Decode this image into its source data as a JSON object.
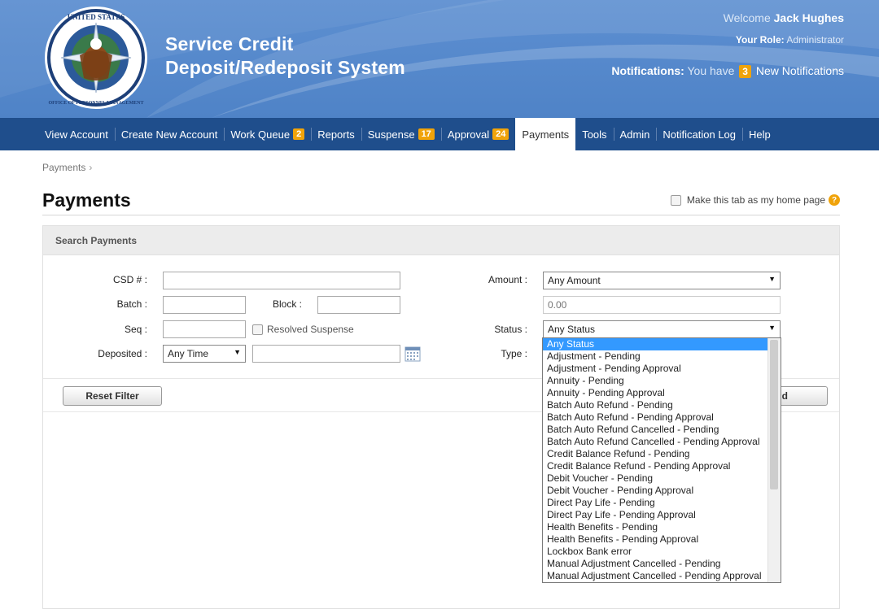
{
  "header": {
    "title_line1": "Service Credit",
    "title_line2": "Deposit/Redeposit System",
    "welcome_prefix": "Welcome",
    "user_name": "Jack Hughes",
    "role_label": "Your Role:",
    "role_value": "Administrator",
    "notifications_label": "Notifications:",
    "notifications_prefix": "You have",
    "notifications_count": "3",
    "notifications_suffix": "New Notifications",
    "seal_text_top": "UNITED STATES",
    "seal_text_bottom": "OFFICE OF PERSONNEL MANAGEMENT"
  },
  "nav": {
    "items": [
      {
        "label": "View Account",
        "badge": ""
      },
      {
        "label": "Create New Account",
        "badge": ""
      },
      {
        "label": "Work Queue",
        "badge": "2"
      },
      {
        "label": "Reports",
        "badge": ""
      },
      {
        "label": "Suspense",
        "badge": "17"
      },
      {
        "label": "Approval",
        "badge": "24"
      },
      {
        "label": "Payments",
        "badge": ""
      },
      {
        "label": "Tools",
        "badge": ""
      },
      {
        "label": "Admin",
        "badge": ""
      },
      {
        "label": "Notification Log",
        "badge": ""
      },
      {
        "label": "Help",
        "badge": ""
      }
    ],
    "active": "Payments"
  },
  "breadcrumb": {
    "current": "Payments",
    "sep": "›"
  },
  "page": {
    "title": "Payments",
    "home_checkbox_label": "Make this tab as my home page",
    "help_glyph": "?"
  },
  "search": {
    "panel_title": "Search Payments",
    "csd_label": "CSD # :",
    "batch_label": "Batch :",
    "block_label": "Block :",
    "seq_label": "Seq :",
    "resolved_label": "Resolved Suspense",
    "deposited_label": "Deposited :",
    "deposited_value": "Any Time",
    "amount_label": "Amount :",
    "amount_value": "Any Amount",
    "amount_placeholder": "0.00",
    "status_label": "Status :",
    "status_value": "Any Status",
    "type_label": "Type :",
    "reset_button": "Reset Filter",
    "search_button_partial": "d"
  },
  "status_options": [
    "Any Status",
    "Adjustment - Pending",
    "Adjustment - Pending Approval",
    "Annuity - Pending",
    "Annuity - Pending Approval",
    "Batch Auto Refund - Pending",
    "Batch Auto Refund - Pending Approval",
    "Batch Auto Refund Cancelled - Pending",
    "Batch Auto Refund Cancelled - Pending Approval",
    "Credit Balance Refund - Pending",
    "Credit Balance Refund - Pending Approval",
    "Debit Voucher - Pending",
    "Debit Voucher - Pending Approval",
    "Direct Pay Life - Pending",
    "Direct Pay Life - Pending Approval",
    "Health Benefits - Pending",
    "Health Benefits - Pending Approval",
    "Lockbox Bank error",
    "Manual Adjustment Cancelled - Pending",
    "Manual Adjustment Cancelled - Pending Approval"
  ],
  "colors": {
    "header_blue": "#4f83c7",
    "nav_blue": "#1f4e8c",
    "badge_orange": "#f0a30a",
    "selection_blue": "#3399ff"
  }
}
